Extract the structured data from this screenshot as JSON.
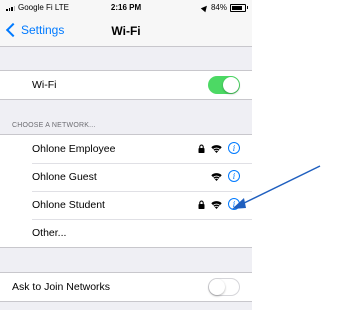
{
  "statusbar": {
    "carrier": "Google Fi  LTE",
    "time": "2:16 PM",
    "battery": "84%"
  },
  "navbar": {
    "back_label": "Settings",
    "title": "Wi-Fi"
  },
  "wifi": {
    "label": "Wi-Fi",
    "enabled": true
  },
  "section_header": "CHOOSE A NETWORK...",
  "networks": [
    {
      "name": "Ohlone Employee",
      "locked": true
    },
    {
      "name": "Ohlone Guest",
      "locked": false
    },
    {
      "name": "Ohlone Student",
      "locked": true
    },
    {
      "name": "Other..."
    }
  ],
  "ask_join": {
    "label": "Ask to Join Networks",
    "enabled": false
  },
  "colors": {
    "accent": "#007aff",
    "toggle_on": "#4cd964",
    "annotation_arrow": "#1f5fbf"
  }
}
